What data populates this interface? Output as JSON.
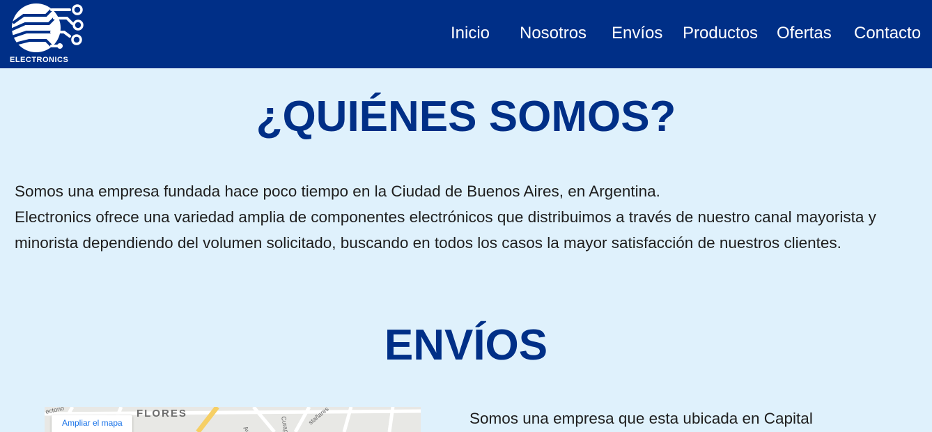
{
  "header": {
    "logo_text": "ELECTRONICS",
    "nav": [
      "Inicio",
      "Nosotros",
      "Envíos",
      "Productos",
      "Ofertas",
      "Contacto"
    ]
  },
  "about": {
    "title": "¿QUIÉNES SOMOS?",
    "line1": "Somos una empresa fundada hace poco tiempo en la Ciudad de Buenos Aires, en Argentina.",
    "line2": "Electronics ofrece una variedad amplia de componentes electrónicos que distribuimos a través de nuestro canal mayorista y minorista dependiendo del volumen solicitado, buscando en todos los casos la mayor satisfacción de nuestros clientes."
  },
  "envios": {
    "title": "ENVÍOS",
    "text": "Somos una empresa que esta ubicada en Capital",
    "map": {
      "area_label": "FLORES",
      "expand_button": "Ampliar el mapa"
    }
  },
  "colors": {
    "header_bg": "#002f87",
    "page_bg": "#dff1fc",
    "title": "#002f87"
  }
}
